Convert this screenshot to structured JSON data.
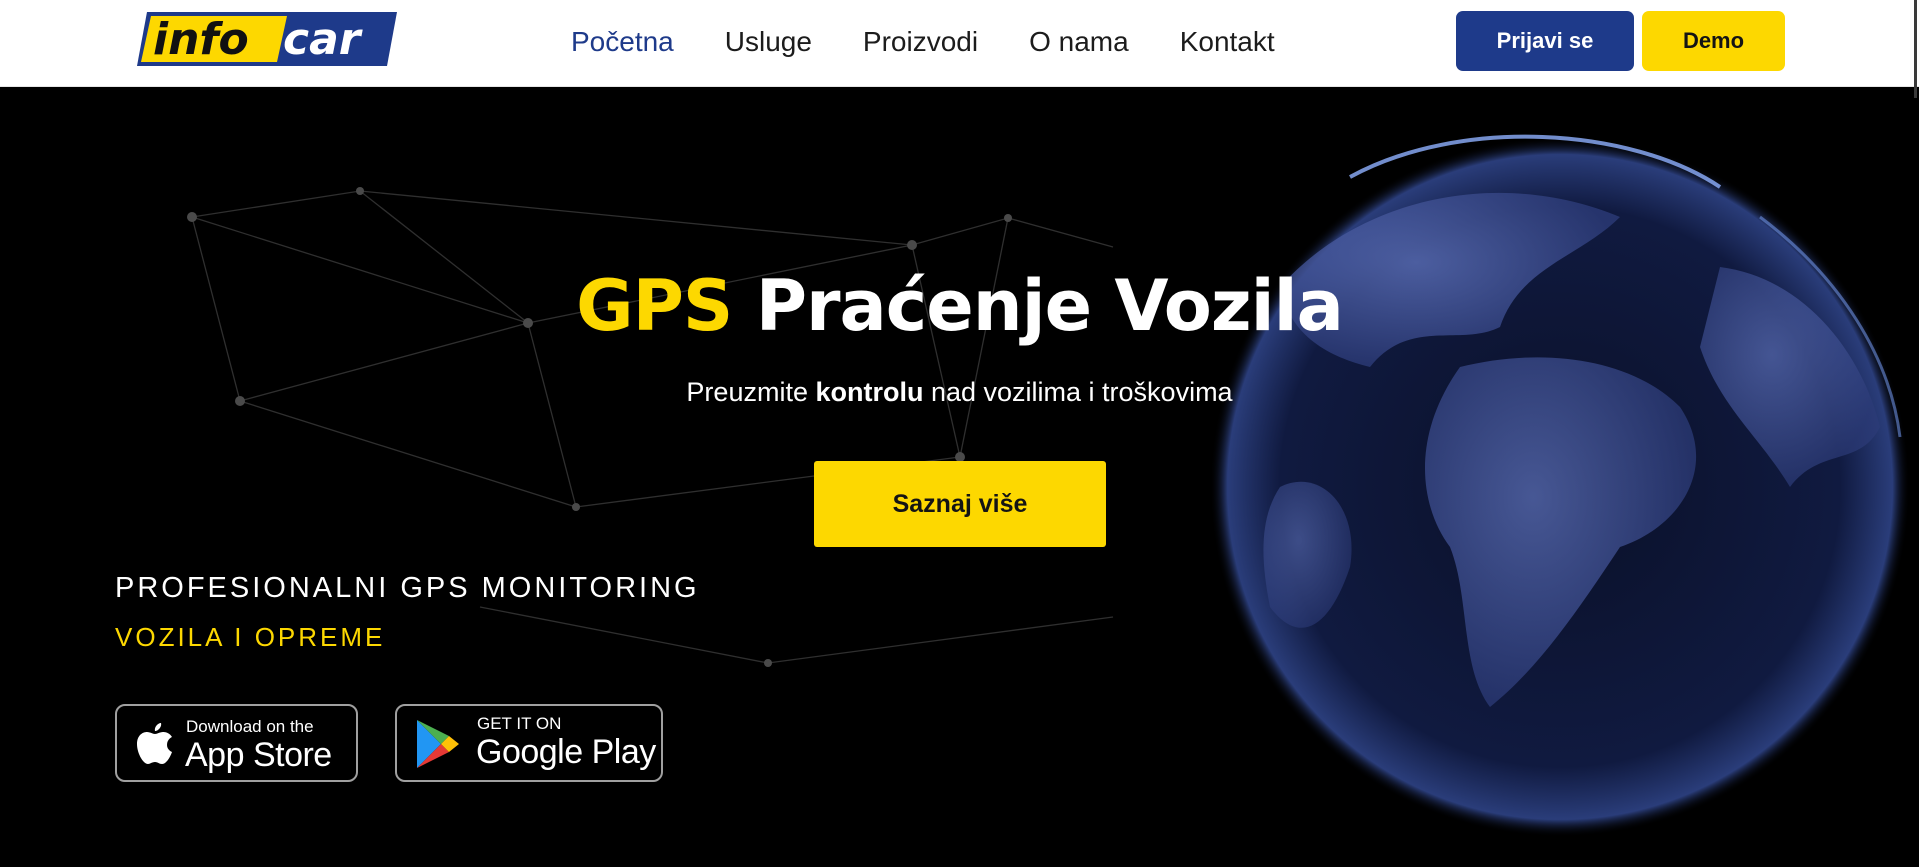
{
  "header": {
    "logo": {
      "part1": "info",
      "part2": "car"
    },
    "nav": [
      {
        "label": "Početna",
        "active": true
      },
      {
        "label": "Usluge",
        "active": false
      },
      {
        "label": "Proizvodi",
        "active": false
      },
      {
        "label": "O nama",
        "active": false
      },
      {
        "label": "Kontakt",
        "active": false
      }
    ],
    "login_label": "Prijavi se",
    "demo_label": "Demo"
  },
  "hero": {
    "title_highlight": "GPS",
    "title_rest": " Praćenje Vozila",
    "subtitle_pre": "Preuzmite ",
    "subtitle_bold": "kontrolu",
    "subtitle_post": " nad vozilima i troškovima",
    "cta_label": "Saznaj više",
    "tagline_1": "PROFESIONALNI GPS MONITORING",
    "tagline_2": "VOZILA I OPREME"
  },
  "stores": {
    "apple": {
      "small": "Download on the",
      "big": "App Store",
      "icon": "apple-icon"
    },
    "google": {
      "small": "GET IT ON",
      "big": "Google Play",
      "icon": "google-play-icon"
    }
  },
  "colors": {
    "brand_blue": "#1e3a8a",
    "brand_yellow": "#fdd800",
    "background": "#000000"
  }
}
